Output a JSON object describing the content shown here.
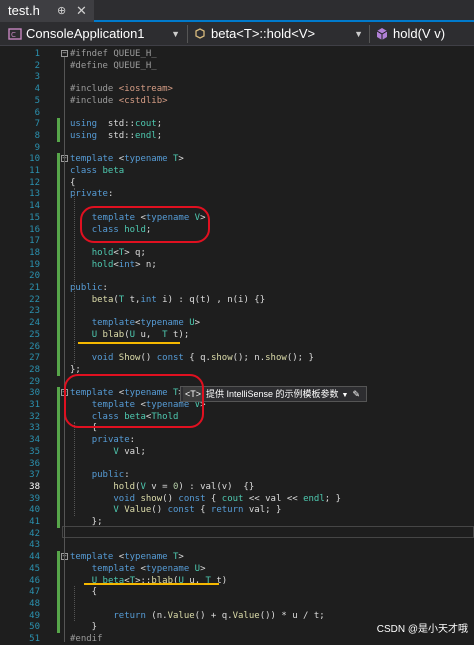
{
  "tab": {
    "title": "test.h",
    "pin": "⊕",
    "close": "✕"
  },
  "nav": {
    "project": "ConsoleApplication1",
    "scope": "beta<T>::hold<V>",
    "member": "hold(V v)"
  },
  "lines": [
    {
      "n": "1",
      "segs": [
        [
          "pp",
          "#ifndef QUEUE_H_"
        ]
      ]
    },
    {
      "n": "2",
      "segs": [
        [
          "pp",
          "#define QUEUE_H_"
        ]
      ]
    },
    {
      "n": "3",
      "segs": []
    },
    {
      "n": "4",
      "segs": [
        [
          "pp",
          "#include "
        ],
        [
          "inc",
          "<iostream>"
        ]
      ]
    },
    {
      "n": "5",
      "segs": [
        [
          "pp",
          "#include "
        ],
        [
          "inc",
          "<cstdlib>"
        ]
      ]
    },
    {
      "n": "6",
      "segs": []
    },
    {
      "n": "7",
      "segs": [
        [
          "kw",
          "using"
        ],
        [
          "",
          "  std::"
        ],
        [
          "ty",
          "cout"
        ],
        [
          "",
          ";"
        ]
      ]
    },
    {
      "n": "8",
      "segs": [
        [
          "kw",
          "using"
        ],
        [
          "",
          "  std::"
        ],
        [
          "ty",
          "endl"
        ],
        [
          "",
          ";"
        ]
      ]
    },
    {
      "n": "9",
      "segs": []
    },
    {
      "n": "10",
      "segs": [
        [
          "kw",
          "template"
        ],
        [
          "",
          " <"
        ],
        [
          "kw",
          "typename"
        ],
        [
          "",
          " "
        ],
        [
          "ty",
          "T"
        ],
        [
          "",
          ">"
        ]
      ]
    },
    {
      "n": "11",
      "segs": [
        [
          "kw",
          "class"
        ],
        [
          "",
          " "
        ],
        [
          "ty",
          "beta"
        ]
      ]
    },
    {
      "n": "12",
      "segs": [
        [
          "",
          "{"
        ]
      ]
    },
    {
      "n": "13",
      "segs": [
        [
          "kw",
          "private"
        ],
        [
          "",
          ":"
        ]
      ]
    },
    {
      "n": "14",
      "segs": []
    },
    {
      "n": "15",
      "segs": [
        [
          "",
          "    "
        ],
        [
          "kw",
          "template"
        ],
        [
          "",
          " <"
        ],
        [
          "kw",
          "typename"
        ],
        [
          "",
          " "
        ],
        [
          "ty",
          "V"
        ],
        [
          "",
          ">"
        ]
      ]
    },
    {
      "n": "16",
      "segs": [
        [
          "",
          "    "
        ],
        [
          "kw",
          "class"
        ],
        [
          "",
          " "
        ],
        [
          "ty",
          "hold"
        ],
        [
          "",
          ";"
        ]
      ]
    },
    {
      "n": "17",
      "segs": []
    },
    {
      "n": "18",
      "segs": [
        [
          "",
          "    "
        ],
        [
          "ty",
          "hold"
        ],
        [
          "",
          "<"
        ],
        [
          "ty",
          "T"
        ],
        [
          "",
          "> q;"
        ]
      ]
    },
    {
      "n": "19",
      "segs": [
        [
          "",
          "    "
        ],
        [
          "ty",
          "hold"
        ],
        [
          "",
          "<"
        ],
        [
          "kw",
          "int"
        ],
        [
          "",
          "> n;"
        ]
      ]
    },
    {
      "n": "20",
      "segs": []
    },
    {
      "n": "21",
      "segs": [
        [
          "kw",
          "public"
        ],
        [
          "",
          ":"
        ]
      ]
    },
    {
      "n": "22",
      "segs": [
        [
          "",
          "    "
        ],
        [
          "fn",
          "beta"
        ],
        [
          "",
          "("
        ],
        [
          "ty",
          "T"
        ],
        [
          "",
          " t,"
        ],
        [
          "kw",
          "int"
        ],
        [
          "",
          " i) : q(t) , n(i) {}"
        ]
      ]
    },
    {
      "n": "23",
      "segs": []
    },
    {
      "n": "24",
      "segs": [
        [
          "",
          "    "
        ],
        [
          "kw",
          "template"
        ],
        [
          "",
          "<"
        ],
        [
          "kw",
          "typename"
        ],
        [
          "",
          " "
        ],
        [
          "ty",
          "U"
        ],
        [
          "",
          ">"
        ]
      ]
    },
    {
      "n": "25",
      "segs": [
        [
          "",
          "    "
        ],
        [
          "ty",
          "U"
        ],
        [
          "",
          " "
        ],
        [
          "fn",
          "blab"
        ],
        [
          "",
          "("
        ],
        [
          "ty",
          "U"
        ],
        [
          "",
          " u,  "
        ],
        [
          "ty",
          "T"
        ],
        [
          "",
          " t);"
        ]
      ]
    },
    {
      "n": "26",
      "segs": []
    },
    {
      "n": "27",
      "segs": [
        [
          "",
          "    "
        ],
        [
          "kw",
          "void"
        ],
        [
          "",
          " "
        ],
        [
          "fn",
          "Show"
        ],
        [
          "",
          "() "
        ],
        [
          "kw",
          "const"
        ],
        [
          "",
          " { q."
        ],
        [
          "fn",
          "show"
        ],
        [
          "",
          "(); n."
        ],
        [
          "fn",
          "show"
        ],
        [
          "",
          "(); }"
        ]
      ]
    },
    {
      "n": "28",
      "segs": [
        [
          "",
          "};"
        ]
      ]
    },
    {
      "n": "29",
      "segs": []
    },
    {
      "n": "30",
      "segs": [
        [
          "kw",
          "template"
        ],
        [
          "",
          " <"
        ],
        [
          "kw",
          "typename"
        ],
        [
          "",
          " "
        ],
        [
          "ty",
          "T"
        ],
        [
          "",
          ">"
        ]
      ]
    },
    {
      "n": "31",
      "segs": [
        [
          "",
          "    "
        ],
        [
          "kw",
          "template"
        ],
        [
          "",
          " <"
        ],
        [
          "kw",
          "typename"
        ],
        [
          "",
          " "
        ],
        [
          "ty",
          "V"
        ],
        [
          "",
          ">"
        ]
      ]
    },
    {
      "n": "32",
      "segs": [
        [
          "",
          "    "
        ],
        [
          "kw",
          "class"
        ],
        [
          "",
          " "
        ],
        [
          "ty",
          "beta"
        ],
        [
          "",
          "<"
        ],
        [
          "ty",
          "T"
        ],
        [
          ">::"
        ],
        [
          "ty",
          "hold"
        ]
      ]
    },
    {
      "n": "33",
      "segs": [
        [
          "",
          "    {"
        ]
      ]
    },
    {
      "n": "34",
      "segs": [
        [
          "",
          "    "
        ],
        [
          "kw",
          "private"
        ],
        [
          "",
          ":"
        ]
      ]
    },
    {
      "n": "35",
      "segs": [
        [
          "",
          "        "
        ],
        [
          "ty",
          "V"
        ],
        [
          "",
          " val;"
        ]
      ]
    },
    {
      "n": "36",
      "segs": []
    },
    {
      "n": "37",
      "segs": [
        [
          "",
          "    "
        ],
        [
          "kw",
          "public"
        ],
        [
          "",
          ":"
        ]
      ]
    },
    {
      "n": "38",
      "segs": [
        [
          "",
          "        "
        ],
        [
          "fn",
          "hold"
        ],
        [
          "",
          "("
        ],
        [
          "ty",
          "V"
        ],
        [
          "",
          " v = "
        ],
        [
          "nm",
          "0"
        ],
        [
          "",
          ") : val(v)  {}"
        ]
      ]
    },
    {
      "n": "39",
      "segs": [
        [
          "",
          "        "
        ],
        [
          "kw",
          "void"
        ],
        [
          "",
          " "
        ],
        [
          "fn",
          "show"
        ],
        [
          "",
          "() "
        ],
        [
          "kw",
          "const"
        ],
        [
          "",
          " { "
        ],
        [
          "ty",
          "cout"
        ],
        [
          "",
          " << val << "
        ],
        [
          "ty",
          "endl"
        ],
        [
          "",
          "; }"
        ]
      ]
    },
    {
      "n": "40",
      "segs": [
        [
          "",
          "        "
        ],
        [
          "ty",
          "V"
        ],
        [
          "",
          " "
        ],
        [
          "fn",
          "Value"
        ],
        [
          "",
          "() "
        ],
        [
          "kw",
          "const"
        ],
        [
          "",
          " { "
        ],
        [
          "kw",
          "return"
        ],
        [
          "",
          " val; }"
        ]
      ]
    },
    {
      "n": "41",
      "segs": [
        [
          "",
          "    };"
        ]
      ]
    },
    {
      "n": "42",
      "segs": []
    },
    {
      "n": "43",
      "segs": []
    },
    {
      "n": "44",
      "segs": [
        [
          "kw",
          "template"
        ],
        [
          "",
          " <"
        ],
        [
          "kw",
          "typename"
        ],
        [
          "",
          " "
        ],
        [
          "ty",
          "T"
        ],
        [
          "",
          ">"
        ]
      ]
    },
    {
      "n": "45",
      "segs": [
        [
          "",
          "    "
        ],
        [
          "kw",
          "template"
        ],
        [
          "",
          " <"
        ],
        [
          "kw",
          "typename"
        ],
        [
          "",
          " "
        ],
        [
          "ty",
          "U"
        ],
        [
          "",
          ">"
        ]
      ]
    },
    {
      "n": "46",
      "segs": [
        [
          "",
          "    "
        ],
        [
          "ty",
          "U"
        ],
        [
          "",
          " "
        ],
        [
          "ty",
          "beta"
        ],
        [
          "",
          "<"
        ],
        [
          "ty",
          "T"
        ],
        [
          "",
          ">::"
        ],
        [
          "fn",
          "blab"
        ],
        [
          "",
          "("
        ],
        [
          "ty",
          "U"
        ],
        [
          "",
          " u, "
        ],
        [
          "ty",
          "T"
        ],
        [
          "",
          " t)"
        ]
      ]
    },
    {
      "n": "47",
      "segs": [
        [
          "",
          "    {"
        ]
      ]
    },
    {
      "n": "48",
      "segs": []
    },
    {
      "n": "49",
      "segs": [
        [
          "",
          "        "
        ],
        [
          "kw",
          "return"
        ],
        [
          "",
          " (n."
        ],
        [
          "fn",
          "Value"
        ],
        [
          "",
          "() + q."
        ],
        [
          "fn",
          "Value"
        ],
        [
          "",
          "()) * u / t;"
        ]
      ]
    },
    {
      "n": "50",
      "segs": [
        [
          "",
          "    }"
        ]
      ]
    },
    {
      "n": "51",
      "segs": [
        [
          "pp",
          "#endif"
        ]
      ]
    }
  ],
  "current_line": "38",
  "hint": {
    "badge": "<T>",
    "text": "提供 IntelliSense 的示例模板参数",
    "caret": "▼",
    "pen": "✎"
  },
  "watermark": "CSDN @是小天才哦",
  "colors": {
    "accent": "#007acc",
    "annotation": "#e01020",
    "underline": "#f5b800"
  }
}
